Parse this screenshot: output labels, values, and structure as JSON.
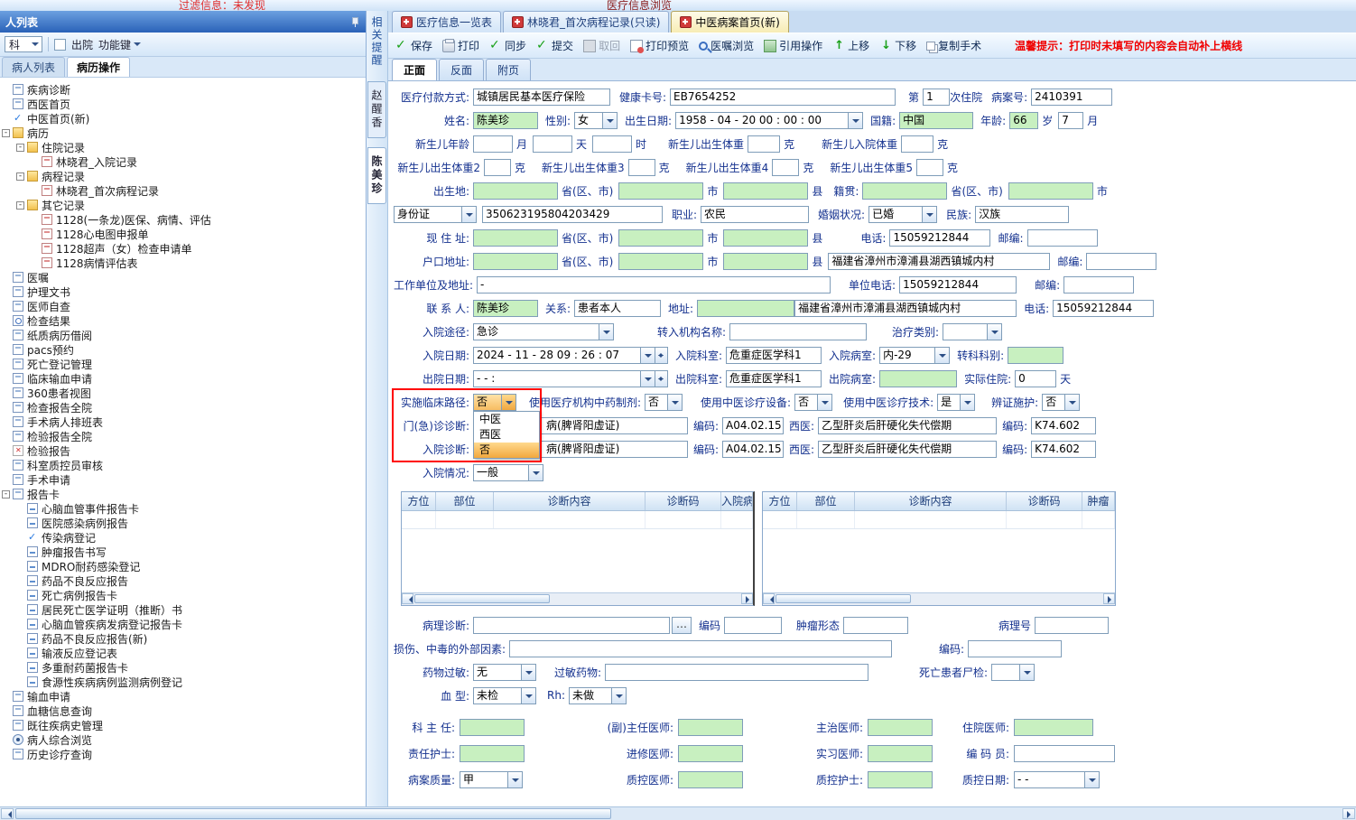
{
  "chrome": {
    "top_cut_left": "过滤信息：未发现",
    "top_cut_center": "医疗信息浏览"
  },
  "left_panel": {
    "caption": "人列表",
    "toolbar": {
      "dept_label": "科",
      "discharge_label": "出院",
      "fnkeys_label": "功能键"
    },
    "tabs": [
      {
        "label": "病人列表",
        "active": false
      },
      {
        "label": "病历操作",
        "active": true
      }
    ],
    "tree": [
      {
        "label": "疾病诊断",
        "indent": 0,
        "icon": "doc-icon"
      },
      {
        "label": "西医首页",
        "indent": 0,
        "icon": "doc-icon"
      },
      {
        "label": "中医首页(新)",
        "indent": 0,
        "icon": "check-icon"
      },
      {
        "label": "病历",
        "indent": 0,
        "icon": "folder-icon",
        "exp": "-"
      },
      {
        "label": "住院记录",
        "indent": 1,
        "icon": "folder-icon",
        "exp": "-"
      },
      {
        "label": "林晓君_入院记录",
        "indent": 2,
        "icon": "doc-red-icon"
      },
      {
        "label": "病程记录",
        "indent": 1,
        "icon": "folder-icon",
        "exp": "-"
      },
      {
        "label": "林晓君_首次病程记录",
        "indent": 2,
        "icon": "doc-red-icon"
      },
      {
        "label": "其它记录",
        "indent": 1,
        "icon": "folder-icon",
        "exp": "-"
      },
      {
        "label": "1128(一条龙)医保、病情、评估",
        "indent": 2,
        "icon": "doc-red-icon"
      },
      {
        "label": "1128心电图申报单",
        "indent": 2,
        "icon": "doc-red-icon"
      },
      {
        "label": "1128超声（女）检查申请单",
        "indent": 2,
        "icon": "doc-red-icon"
      },
      {
        "label": "1128病情评估表",
        "indent": 2,
        "icon": "doc-red-icon"
      },
      {
        "label": "医嘱",
        "indent": 0,
        "icon": "doc-icon"
      },
      {
        "label": "护理文书",
        "indent": 0,
        "icon": "doc-icon"
      },
      {
        "label": "医师自查",
        "indent": 0,
        "icon": "doc-icon"
      },
      {
        "label": "检查结果",
        "indent": 0,
        "icon": "search-doc-icon"
      },
      {
        "label": "纸质病历借阅",
        "indent": 0,
        "icon": "doc-icon"
      },
      {
        "label": "pacs预约",
        "indent": 0,
        "icon": "doc-icon"
      },
      {
        "label": "死亡登记管理",
        "indent": 0,
        "icon": "doc-icon"
      },
      {
        "label": "临床输血申请",
        "indent": 0,
        "icon": "doc-icon"
      },
      {
        "label": "360患者视图",
        "indent": 0,
        "icon": "doc-icon"
      },
      {
        "label": "检查报告全院",
        "indent": 0,
        "icon": "doc-icon"
      },
      {
        "label": "手术病人排班表",
        "indent": 0,
        "icon": "doc-icon"
      },
      {
        "label": "检验报告全院",
        "indent": 0,
        "icon": "doc-icon"
      },
      {
        "label": "检验报告",
        "indent": 0,
        "icon": "doc-x-icon"
      },
      {
        "label": "科室质控员审核",
        "indent": 0,
        "icon": "doc-icon"
      },
      {
        "label": "手术申请",
        "indent": 0,
        "icon": "doc-icon"
      },
      {
        "label": "报告卡",
        "indent": 0,
        "icon": "doc-icon",
        "exp": "-"
      },
      {
        "label": "心脑血管事件报告卡",
        "indent": 1,
        "icon": "doc-blue-icon"
      },
      {
        "label": "医院感染病例报告",
        "indent": 1,
        "icon": "doc-blue-icon"
      },
      {
        "label": "传染病登记",
        "indent": 1,
        "icon": "check-icon"
      },
      {
        "label": "肿瘤报告书写",
        "indent": 1,
        "icon": "doc-blue-icon"
      },
      {
        "label": "MDRO耐药感染登记",
        "indent": 1,
        "icon": "doc-blue-icon"
      },
      {
        "label": "药品不良反应报告",
        "indent": 1,
        "icon": "doc-blue-icon"
      },
      {
        "label": "死亡病例报告卡",
        "indent": 1,
        "icon": "doc-blue-icon"
      },
      {
        "label": "居民死亡医学证明（推断）书",
        "indent": 1,
        "icon": "doc-blue-icon"
      },
      {
        "label": "心脑血管疾病发病登记报告卡",
        "indent": 1,
        "icon": "doc-blue-icon"
      },
      {
        "label": "药品不良反应报告(新)",
        "indent": 1,
        "icon": "doc-blue-icon"
      },
      {
        "label": "输液反应登记表",
        "indent": 1,
        "icon": "doc-blue-icon"
      },
      {
        "label": "多重耐药菌报告卡",
        "indent": 1,
        "icon": "doc-blue-icon"
      },
      {
        "label": "食源性疾病病例监测病例登记",
        "indent": 1,
        "icon": "doc-blue-icon"
      },
      {
        "label": "输血申请",
        "indent": 0,
        "icon": "doc-icon"
      },
      {
        "label": "血糖信息查询",
        "indent": 0,
        "icon": "doc-icon"
      },
      {
        "label": "既往疾病史管理",
        "indent": 0,
        "icon": "doc-icon"
      },
      {
        "label": "病人综合浏览",
        "indent": 0,
        "icon": "eye-icon"
      },
      {
        "label": "历史诊疗查询",
        "indent": 0,
        "icon": "doc-icon"
      }
    ]
  },
  "side_strip": {
    "reminder": "相关提醒",
    "patients": [
      {
        "name": "赵醒香",
        "active": false
      },
      {
        "name": "陈美珍",
        "active": true
      }
    ]
  },
  "doc_tabs": [
    {
      "label": "医疗信息一览表",
      "active": false
    },
    {
      "label": "林晓君_首次病程记录(只读)",
      "active": false
    },
    {
      "label": "中医病案首页(新)",
      "active": true
    }
  ],
  "toolbar": {
    "buttons": [
      {
        "label": "保存",
        "icon": "save-icon"
      },
      {
        "label": "打印",
        "icon": "print-icon"
      },
      {
        "label": "同步",
        "icon": "sync-icon"
      },
      {
        "label": "提交",
        "icon": "submit-icon"
      },
      {
        "label": "取回",
        "icon": "retrieve-icon",
        "disabled": true
      },
      {
        "label": "打印预览",
        "icon": "print-preview-icon"
      },
      {
        "label": "医嘱浏览",
        "icon": "orders-view-icon"
      },
      {
        "label": "引用操作",
        "icon": "quote-icon"
      },
      {
        "label": "上移",
        "icon": "move-up-icon"
      },
      {
        "label": "下移",
        "icon": "move-down-icon"
      },
      {
        "label": "复制手术",
        "icon": "copy-icon"
      }
    ],
    "warning": "温馨提示：打印时未填写的内容会自动补上横线"
  },
  "page_tabs": [
    {
      "label": "正面",
      "active": true
    },
    {
      "label": "反面",
      "active": false
    },
    {
      "label": "附页",
      "active": false
    }
  ],
  "clinical_path_dropdown": {
    "options": [
      {
        "label": "中医",
        "selected": false
      },
      {
        "label": "西医",
        "selected": false
      },
      {
        "label": "否",
        "selected": true
      }
    ]
  },
  "diag_table": {
    "left_headers": [
      "方位",
      "部位",
      "诊断内容",
      "诊断码",
      "入院病"
    ],
    "right_headers": [
      "方位",
      "部位",
      "诊断内容",
      "诊断码",
      "肿瘤"
    ]
  },
  "form": {
    "payment_label": "医疗付款方式:",
    "payment_value": "城镇居民基本医疗保险",
    "health_card_label": "健康卡号:",
    "health_card_value": "EB7654252",
    "admit_count_prefix": "第",
    "admit_count_value": "1",
    "admit_count_suffix": "次住院",
    "record_no_label": "病案号:",
    "record_no_value": "2410391",
    "name_label": "姓名:",
    "name_value": "陈美珍",
    "gender_label": "性别:",
    "gender_value": "女",
    "birth_label": "出生日期:",
    "birth_value": "1958 - 04 - 20    00 : 00 : 00",
    "nationality_label": "国籍:",
    "nationality_value": "中国",
    "age_label": "年龄:",
    "age_value": "66",
    "age_unit1": "岁",
    "age_months": "7",
    "age_unit2": "月",
    "nb_age_label": "新生儿年龄",
    "nb_month": "月",
    "nb_day": "天",
    "nb_hour": "时",
    "nb_weight_label": "新生儿出生体重",
    "nb_admit_weight_label": "新生儿入院体重",
    "gram": "克",
    "nb_weight2_label": "新生儿出生体重2",
    "nb_weight3_label": "新生儿出生体重3",
    "nb_weight4_label": "新生儿出生体重4",
    "nb_weight5_label": "新生儿出生体重5",
    "birthplace_label": "出生地:",
    "province": "省(区、市)",
    "city": "市",
    "county": "县",
    "native_place_label": "籍贯:",
    "id_type_value": "身份证",
    "id_no_value": "350623195804203429",
    "occupation_label": "职业:",
    "occupation_value": "农民",
    "marital_label": "婚姻状况:",
    "marital_value": "已婚",
    "ethnic_label": "民族:",
    "ethnic_value": "汉族",
    "cur_addr_label": "现 住 址:",
    "phone_label": "电话:",
    "phone_value": "15059212844",
    "zip_label": "邮编:",
    "hukou_label": "户口地址:",
    "hukou_addr": "福建省漳州市漳浦县湖西镇城内村",
    "work_label": "工作单位及地址:",
    "work_value": "-",
    "work_phone_label": "单位电话:",
    "work_phone_value": "15059212844",
    "contact_label": "联 系 人:",
    "contact_value": "陈美珍",
    "relation_label": "关系:",
    "relation_value": "患者本人",
    "contact_addr_label": "地址:",
    "contact_addr_value": "福建省漳州市漳浦县湖西镇城内村",
    "contact_phone_value": "15059212844",
    "admit_path_label": "入院途径:",
    "admit_path_value": "急诊",
    "transfer_org_label": "转入机构名称:",
    "therapy_type_label": "治疗类别:",
    "admit_date_label": "入院日期:",
    "admit_date_value": "2024 - 11 - 28    09 : 26 : 07",
    "admit_dept_label": "入院科室:",
    "admit_dept_value": "危重症医学科1",
    "admit_ward_label": "入院病室:",
    "admit_ward_value": "内-29",
    "transfer_dept_label": "转科科别:",
    "discharge_date_label": "出院日期:",
    "discharge_date_value": "-    -           :",
    "discharge_dept_label": "出院科室:",
    "discharge_dept_value": "危重症医学科1",
    "discharge_ward_label": "出院病室:",
    "actual_days_label": "实际住院:",
    "actual_days_value": "0",
    "day_unit": "天",
    "clinical_path_label": "实施临床路径:",
    "clinical_path_value": "否",
    "herbal_label": "使用医疗机构中药制剂:",
    "herbal_value": "否",
    "tcm_device_label": "使用中医诊疗设备:",
    "tcm_device_value": "否",
    "tcm_tech_label": "使用中医诊疗技术:",
    "tcm_tech_value": "是",
    "syndrome_care_label": "辨证施护:",
    "syndrome_care_value": "否",
    "outpatient_diag_label": "门(急)诊诊断:",
    "outpatient_diag_value": "病(脾肾阳虚证)",
    "code_label": "编码:",
    "outpatient_code": "A04.02.15",
    "western_label": "西医:",
    "outpatient_western": "乙型肝炎后肝硬化失代偿期",
    "outpatient_western_code": "K74.602",
    "admit_diag_label": "入院诊断:",
    "admit_diag_value": "病(脾肾阳虚证)",
    "admit_code": "A04.02.15",
    "admit_western": "乙型肝炎后肝硬化失代偿期",
    "admit_western_code": "K74.602",
    "admit_cond_label": "入院情况:",
    "admit_cond_value": "一般",
    "pathology_label": "病理诊断:",
    "ellipsis": "…",
    "pathology_code_label": "编码",
    "tumor_label": "肿瘤形态",
    "pathology_no_label": "病理号",
    "injury_label": "损伤、中毒的外部因素:",
    "injury_code_label": "编码:",
    "allergy_label": "药物过敏:",
    "allergy_value": "无",
    "allergy_drug_label": "过敏药物:",
    "autopsy_label": "死亡患者尸检:",
    "blood_label": "血    型:",
    "blood_value": "未检",
    "rh_label": "Rh:",
    "rh_value": "未做",
    "chief_label": "科 主 任:",
    "deputy_label": "(副)主任医师:",
    "attending_label": "主治医师:",
    "resident_label": "住院医师:",
    "nurse_label": "责任护士:",
    "refresher_label": "进修医师:",
    "intern_label": "实习医师:",
    "coder_label": "编 码 员:",
    "quality_label": "病案质量:",
    "quality_value": "甲",
    "qc_doctor_label": "质控医师:",
    "qc_nurse_label": "质控护士:",
    "qc_date_label": "质控日期:",
    "qc_date_value": "-    -"
  }
}
